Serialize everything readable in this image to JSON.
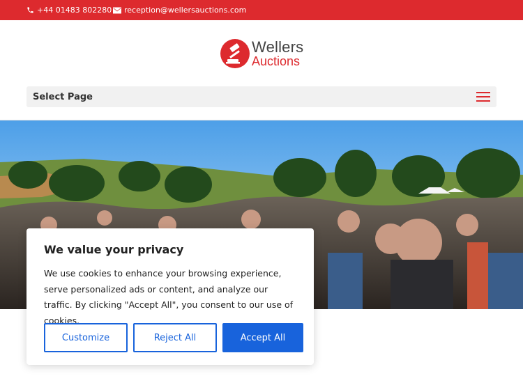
{
  "topbar": {
    "phone": "+44 01483 802280",
    "email": "reception@wellersauctions.com",
    "phone_icon": "phone-icon",
    "email_icon": "envelope-icon"
  },
  "logo": {
    "line1": "Wellers",
    "line2": "Auctions",
    "icon": "gavel-icon"
  },
  "nav": {
    "select_label": "Select Page",
    "menu_icon": "hamburger-icon"
  },
  "hero": {
    "image": "auction-crowd-photo"
  },
  "cookie": {
    "title": "We value your privacy",
    "body": "We use cookies to enhance your browsing experience, serve personalized ads or content, and analyze our traffic. By clicking \"Accept All\", you consent to our use of cookies.",
    "customize_label": "Customize",
    "reject_label": "Reject All",
    "accept_label": "Accept All"
  },
  "colors": {
    "brand_red": "#dd2a2e",
    "consent_blue": "#1863dc"
  }
}
